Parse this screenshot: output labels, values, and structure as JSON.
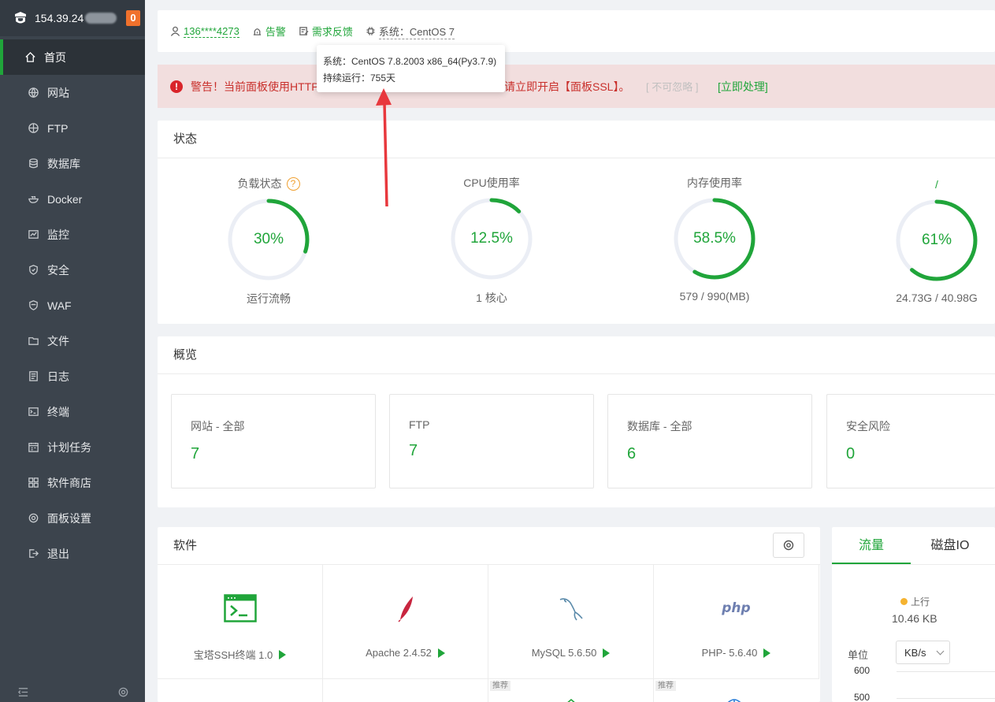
{
  "sidebar": {
    "ip": "154.39.24",
    "badge": "0",
    "items": [
      {
        "label": "首页",
        "icon": "home-icon"
      },
      {
        "label": "网站",
        "icon": "globe-icon"
      },
      {
        "label": "FTP",
        "icon": "ftp-globe-icon"
      },
      {
        "label": "数据库",
        "icon": "database-icon"
      },
      {
        "label": "Docker",
        "icon": "docker-icon"
      },
      {
        "label": "监控",
        "icon": "monitor-icon"
      },
      {
        "label": "安全",
        "icon": "shield-icon"
      },
      {
        "label": "WAF",
        "icon": "waf-shield-icon"
      },
      {
        "label": "文件",
        "icon": "folder-icon"
      },
      {
        "label": "日志",
        "icon": "log-icon"
      },
      {
        "label": "终端",
        "icon": "terminal-icon"
      },
      {
        "label": "计划任务",
        "icon": "calendar-icon"
      },
      {
        "label": "软件商店",
        "icon": "grid-icon"
      },
      {
        "label": "面板设置",
        "icon": "settings-icon"
      },
      {
        "label": "退出",
        "icon": "logout-icon"
      }
    ]
  },
  "topbar": {
    "user": "136****4273",
    "alarm": "告警",
    "feedback": "需求反馈",
    "system": "系统：CentOS 7"
  },
  "tooltip": {
    "line1": "系统：CentOS 7.8.2003 x86_64(Py3.7.9)",
    "line2": "持续运行：755天"
  },
  "alert": {
    "text_left": "警告！当前面板使用HTTP",
    "text_right": "请立即开启【面板SSL】。",
    "ignore": "[ 不可忽略 ]",
    "handle": "[立即处理]"
  },
  "status": {
    "title": "状态",
    "gauges": [
      {
        "label": "负载状态",
        "value": "30%",
        "percent": 30,
        "sub": "运行流畅",
        "help": "?"
      },
      {
        "label": "CPU使用率",
        "value": "12.5%",
        "percent": 12.5,
        "sub": "1 核心"
      },
      {
        "label": "内存使用率",
        "value": "58.5%",
        "percent": 58.5,
        "sub": "579 / 990(MB)"
      },
      {
        "label": "/",
        "value": "61%",
        "percent": 61,
        "sub": "24.73G / 40.98G"
      }
    ]
  },
  "overview": {
    "title": "概览",
    "boxes": [
      {
        "label": "网站 - 全部",
        "value": "7"
      },
      {
        "label": "FTP",
        "value": "7"
      },
      {
        "label": "数据库 - 全部",
        "value": "6"
      },
      {
        "label": "安全风险",
        "value": "0"
      }
    ]
  },
  "software": {
    "title": "软件",
    "items": [
      {
        "name": "宝塔SSH终端 1.0"
      },
      {
        "name": "Apache 2.4.52"
      },
      {
        "name": "MySQL 5.6.50"
      },
      {
        "name": "PHP- 5.6.40"
      }
    ],
    "recommend": "推荐",
    "php_logo": "php"
  },
  "traffic": {
    "tabs": [
      "流量",
      "磁盘IO"
    ],
    "legend": "上行",
    "value": "10.46 KB",
    "unit_label": "单位",
    "unit": "KB/s",
    "y_ticks": [
      "600",
      "500"
    ]
  },
  "colors": {
    "accent": "#20a53a",
    "warning": "#f0712c",
    "danger": "#d9242a"
  }
}
